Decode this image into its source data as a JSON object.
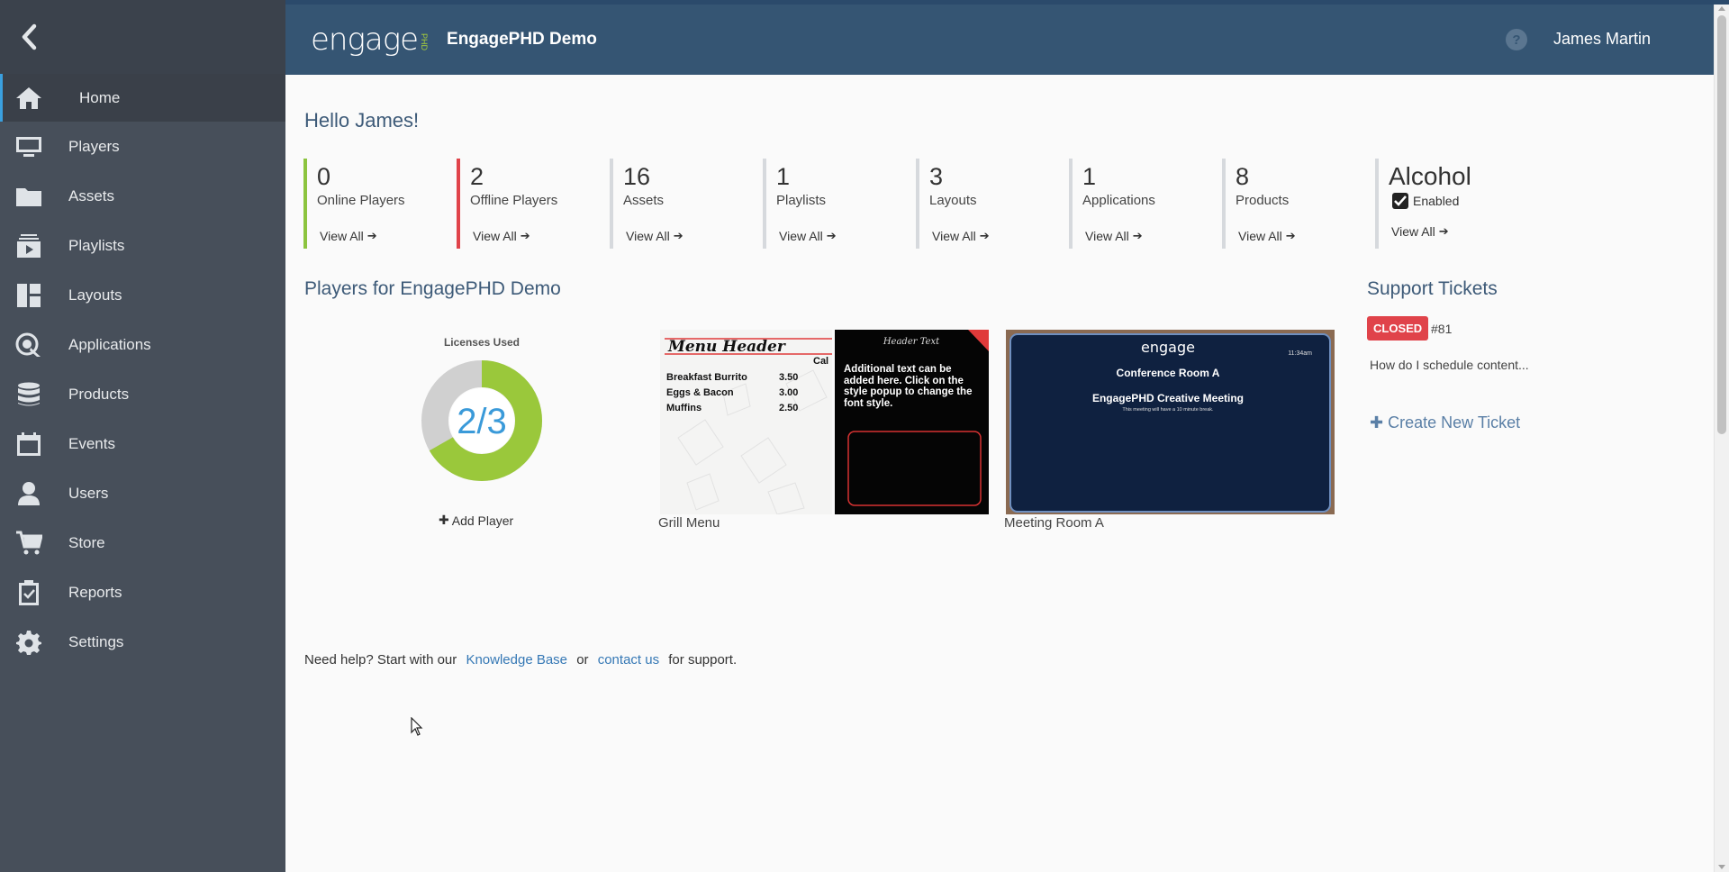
{
  "header": {
    "logo_text": "engage",
    "logo_sub": "PHD",
    "org_name": "EngagePHD Demo",
    "help_icon": "?",
    "user_name": "James Martin"
  },
  "sidebar": {
    "items": [
      {
        "label": "Home",
        "icon": "home-icon"
      },
      {
        "label": "Players",
        "icon": "monitor-icon"
      },
      {
        "label": "Assets",
        "icon": "folder-icon"
      },
      {
        "label": "Playlists",
        "icon": "playlist-icon"
      },
      {
        "label": "Layouts",
        "icon": "layout-icon"
      },
      {
        "label": "Applications",
        "icon": "applications-icon"
      },
      {
        "label": "Products",
        "icon": "database-icon"
      },
      {
        "label": "Events",
        "icon": "calendar-icon"
      },
      {
        "label": "Users",
        "icon": "user-icon"
      },
      {
        "label": "Store",
        "icon": "cart-icon"
      },
      {
        "label": "Reports",
        "icon": "clipboard-icon"
      },
      {
        "label": "Settings",
        "icon": "gear-icon"
      }
    ]
  },
  "main": {
    "greeting": "Hello James!",
    "stats": [
      {
        "value": "0",
        "label": "Online Players",
        "link": "View All"
      },
      {
        "value": "2",
        "label": "Offline Players",
        "link": "View All"
      },
      {
        "value": "16",
        "label": "Assets",
        "link": "View All"
      },
      {
        "value": "1",
        "label": "Playlists",
        "link": "View All"
      },
      {
        "value": "3",
        "label": "Layouts",
        "link": "View All"
      },
      {
        "value": "1",
        "label": "Applications",
        "link": "View All"
      },
      {
        "value": "8",
        "label": "Products",
        "link": "View All"
      },
      {
        "value": "Alcohol",
        "label": "Enabled",
        "link": "View All"
      }
    ],
    "players_title": "Players for EngagePHD Demo",
    "licenses_title": "Licenses Used",
    "licenses_text": "2/3",
    "licenses_used": 2,
    "licenses_total": 3,
    "add_player": "Add Player",
    "players": [
      {
        "name": "Grill Menu"
      },
      {
        "name": "Meeting Room A"
      }
    ],
    "grill_menu": {
      "header": "Menu Header",
      "cal": "Cal",
      "items": [
        {
          "name": "Breakfast Burrito",
          "price": "3.50"
        },
        {
          "name": "Eggs & Bacon",
          "price": "3.00"
        },
        {
          "name": "Muffins",
          "price": "2.50"
        }
      ],
      "right_header": "Header Text",
      "right_text": "Additional text can be added here. Click on the style popup to change the font style."
    },
    "meeting_room": {
      "logo": "engage",
      "time": "11:34am",
      "room": "Conference Room A",
      "meeting": "EngagePHD Creative Meeting",
      "note": "This meeting will have a 10 minute break."
    },
    "support": {
      "title": "Support Tickets",
      "status": "CLOSED",
      "number": "#81",
      "question": "How do I schedule content...",
      "create": "Create New Ticket"
    },
    "help": {
      "prefix": "Need help? Start with our",
      "kb": "Knowledge Base",
      "or": "or",
      "contact": "contact us",
      "suffix": "for support."
    }
  },
  "colors": {
    "header_bg": "#355573",
    "sidebar_bg": "#474f5a",
    "online": "#8cc43f",
    "offline": "#e0434a",
    "donut_used": "#9ac83b",
    "donut_free": "#d0d0d0",
    "donut_text": "#3a9ad9"
  }
}
